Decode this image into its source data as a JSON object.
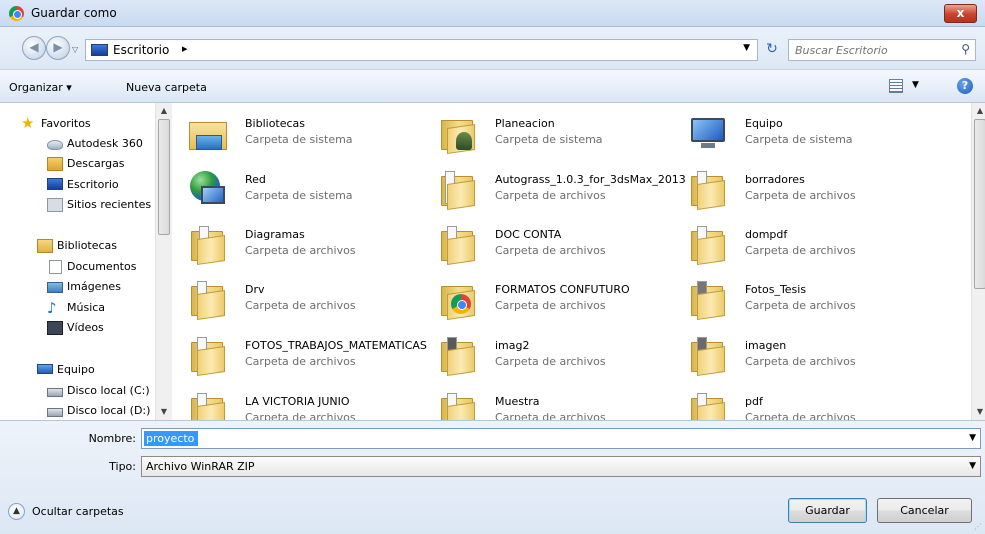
{
  "window": {
    "title": "Guardar como",
    "close_label": "x"
  },
  "address": {
    "crumb": "Escritorio",
    "separator": "▸",
    "search_placeholder": "Buscar Escritorio"
  },
  "toolbar": {
    "organize": "Organizar ▾",
    "new_folder": "Nueva carpeta"
  },
  "sidebar": {
    "items": [
      {
        "label": "Favoritos",
        "icon": "star-icon"
      },
      {
        "label": "Autodesk 360",
        "icon": "cloud-icon"
      },
      {
        "label": "Descargas",
        "icon": "downloads-icon"
      },
      {
        "label": "Escritorio",
        "icon": "desktop-icon"
      },
      {
        "label": "Sitios recientes",
        "icon": "recent-places-icon"
      },
      {
        "label": "Bibliotecas",
        "icon": "libraries-icon"
      },
      {
        "label": "Documentos",
        "icon": "documents-icon"
      },
      {
        "label": "Imágenes",
        "icon": "pictures-icon"
      },
      {
        "label": "Música",
        "icon": "music-icon"
      },
      {
        "label": "Vídeos",
        "icon": "videos-icon"
      },
      {
        "label": "Equipo",
        "icon": "computer-icon"
      },
      {
        "label": "Disco local (C:)",
        "icon": "disk-icon"
      },
      {
        "label": "Disco local (D:)",
        "icon": "disk-icon"
      }
    ]
  },
  "content": {
    "items": [
      {
        "name": "Bibliotecas",
        "type": "Carpeta de sistema",
        "icon": "libraries-folder-icon"
      },
      {
        "name": "Planeacion",
        "type": "Carpeta de sistema",
        "icon": "user-folder-icon"
      },
      {
        "name": "Equipo",
        "type": "Carpeta de sistema",
        "icon": "computer-icon"
      },
      {
        "name": "Red",
        "type": "Carpeta de sistema",
        "icon": "network-icon"
      },
      {
        "name": "Autograss_1.0.3_for_3dsMax_2013",
        "type": "Carpeta de archivos",
        "icon": "folder-icon"
      },
      {
        "name": "borradores",
        "type": "Carpeta de archivos",
        "icon": "folder-icon"
      },
      {
        "name": "Diagramas",
        "type": "Carpeta de archivos",
        "icon": "folder-icon"
      },
      {
        "name": "DOC CONTA",
        "type": "Carpeta de archivos",
        "icon": "folder-icon"
      },
      {
        "name": "dompdf",
        "type": "Carpeta de archivos",
        "icon": "folder-icon"
      },
      {
        "name": "Drv",
        "type": "Carpeta de archivos",
        "icon": "folder-icon"
      },
      {
        "name": "FORMATOS CONFUTURO",
        "type": "Carpeta de archivos",
        "icon": "chrome-folder-icon"
      },
      {
        "name": "Fotos_Tesis",
        "type": "Carpeta de archivos",
        "icon": "folder-icon"
      },
      {
        "name": "FOTOS_TRABAJOS_MATEMATICAS",
        "type": "Carpeta de archivos",
        "icon": "folder-icon"
      },
      {
        "name": "imag2",
        "type": "Carpeta de archivos",
        "icon": "folder-icon"
      },
      {
        "name": "imagen",
        "type": "Carpeta de archivos",
        "icon": "folder-icon"
      },
      {
        "name": "LA VICTORIA JUNIO",
        "type": "Carpeta de archivos",
        "icon": "folder-icon"
      },
      {
        "name": "Muestra",
        "type": "Carpeta de archivos",
        "icon": "folder-icon"
      },
      {
        "name": "pdf",
        "type": "Carpeta de archivos",
        "icon": "folder-icon"
      }
    ]
  },
  "form": {
    "name_label": "Nombre:",
    "name_value": "proyecto",
    "type_label": "Tipo:",
    "type_value": "Archivo WinRAR ZIP",
    "hide_folders": "Ocultar carpetas",
    "save": "Guardar",
    "cancel": "Cancelar"
  },
  "colors": {
    "selection": "#3399ff",
    "title_bg": "#dce8f7",
    "close": "#c7432b"
  }
}
